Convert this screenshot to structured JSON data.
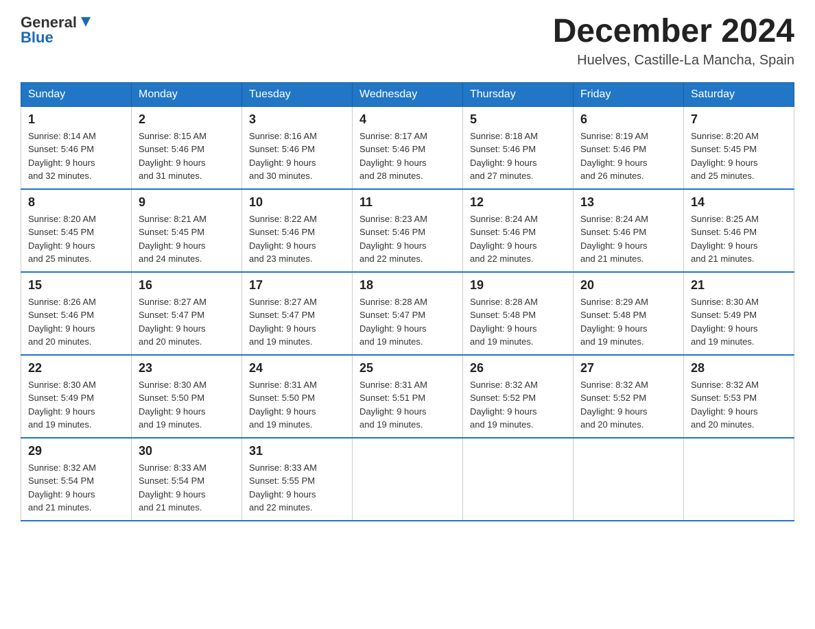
{
  "logo": {
    "general": "General",
    "blue": "Blue"
  },
  "title": "December 2024",
  "location": "Huelves, Castille-La Mancha, Spain",
  "days_of_week": [
    "Sunday",
    "Monday",
    "Tuesday",
    "Wednesday",
    "Thursday",
    "Friday",
    "Saturday"
  ],
  "weeks": [
    [
      {
        "day": "1",
        "sunrise": "8:14 AM",
        "sunset": "5:46 PM",
        "daylight": "9 hours and 32 minutes."
      },
      {
        "day": "2",
        "sunrise": "8:15 AM",
        "sunset": "5:46 PM",
        "daylight": "9 hours and 31 minutes."
      },
      {
        "day": "3",
        "sunrise": "8:16 AM",
        "sunset": "5:46 PM",
        "daylight": "9 hours and 30 minutes."
      },
      {
        "day": "4",
        "sunrise": "8:17 AM",
        "sunset": "5:46 PM",
        "daylight": "9 hours and 28 minutes."
      },
      {
        "day": "5",
        "sunrise": "8:18 AM",
        "sunset": "5:46 PM",
        "daylight": "9 hours and 27 minutes."
      },
      {
        "day": "6",
        "sunrise": "8:19 AM",
        "sunset": "5:46 PM",
        "daylight": "9 hours and 26 minutes."
      },
      {
        "day": "7",
        "sunrise": "8:20 AM",
        "sunset": "5:45 PM",
        "daylight": "9 hours and 25 minutes."
      }
    ],
    [
      {
        "day": "8",
        "sunrise": "8:20 AM",
        "sunset": "5:45 PM",
        "daylight": "9 hours and 25 minutes."
      },
      {
        "day": "9",
        "sunrise": "8:21 AM",
        "sunset": "5:45 PM",
        "daylight": "9 hours and 24 minutes."
      },
      {
        "day": "10",
        "sunrise": "8:22 AM",
        "sunset": "5:46 PM",
        "daylight": "9 hours and 23 minutes."
      },
      {
        "day": "11",
        "sunrise": "8:23 AM",
        "sunset": "5:46 PM",
        "daylight": "9 hours and 22 minutes."
      },
      {
        "day": "12",
        "sunrise": "8:24 AM",
        "sunset": "5:46 PM",
        "daylight": "9 hours and 22 minutes."
      },
      {
        "day": "13",
        "sunrise": "8:24 AM",
        "sunset": "5:46 PM",
        "daylight": "9 hours and 21 minutes."
      },
      {
        "day": "14",
        "sunrise": "8:25 AM",
        "sunset": "5:46 PM",
        "daylight": "9 hours and 21 minutes."
      }
    ],
    [
      {
        "day": "15",
        "sunrise": "8:26 AM",
        "sunset": "5:46 PM",
        "daylight": "9 hours and 20 minutes."
      },
      {
        "day": "16",
        "sunrise": "8:27 AM",
        "sunset": "5:47 PM",
        "daylight": "9 hours and 20 minutes."
      },
      {
        "day": "17",
        "sunrise": "8:27 AM",
        "sunset": "5:47 PM",
        "daylight": "9 hours and 19 minutes."
      },
      {
        "day": "18",
        "sunrise": "8:28 AM",
        "sunset": "5:47 PM",
        "daylight": "9 hours and 19 minutes."
      },
      {
        "day": "19",
        "sunrise": "8:28 AM",
        "sunset": "5:48 PM",
        "daylight": "9 hours and 19 minutes."
      },
      {
        "day": "20",
        "sunrise": "8:29 AM",
        "sunset": "5:48 PM",
        "daylight": "9 hours and 19 minutes."
      },
      {
        "day": "21",
        "sunrise": "8:30 AM",
        "sunset": "5:49 PM",
        "daylight": "9 hours and 19 minutes."
      }
    ],
    [
      {
        "day": "22",
        "sunrise": "8:30 AM",
        "sunset": "5:49 PM",
        "daylight": "9 hours and 19 minutes."
      },
      {
        "day": "23",
        "sunrise": "8:30 AM",
        "sunset": "5:50 PM",
        "daylight": "9 hours and 19 minutes."
      },
      {
        "day": "24",
        "sunrise": "8:31 AM",
        "sunset": "5:50 PM",
        "daylight": "9 hours and 19 minutes."
      },
      {
        "day": "25",
        "sunrise": "8:31 AM",
        "sunset": "5:51 PM",
        "daylight": "9 hours and 19 minutes."
      },
      {
        "day": "26",
        "sunrise": "8:32 AM",
        "sunset": "5:52 PM",
        "daylight": "9 hours and 19 minutes."
      },
      {
        "day": "27",
        "sunrise": "8:32 AM",
        "sunset": "5:52 PM",
        "daylight": "9 hours and 20 minutes."
      },
      {
        "day": "28",
        "sunrise": "8:32 AM",
        "sunset": "5:53 PM",
        "daylight": "9 hours and 20 minutes."
      }
    ],
    [
      {
        "day": "29",
        "sunrise": "8:32 AM",
        "sunset": "5:54 PM",
        "daylight": "9 hours and 21 minutes."
      },
      {
        "day": "30",
        "sunrise": "8:33 AM",
        "sunset": "5:54 PM",
        "daylight": "9 hours and 21 minutes."
      },
      {
        "day": "31",
        "sunrise": "8:33 AM",
        "sunset": "5:55 PM",
        "daylight": "9 hours and 22 minutes."
      },
      null,
      null,
      null,
      null
    ]
  ],
  "labels": {
    "sunrise": "Sunrise:",
    "sunset": "Sunset:",
    "daylight": "Daylight:"
  }
}
